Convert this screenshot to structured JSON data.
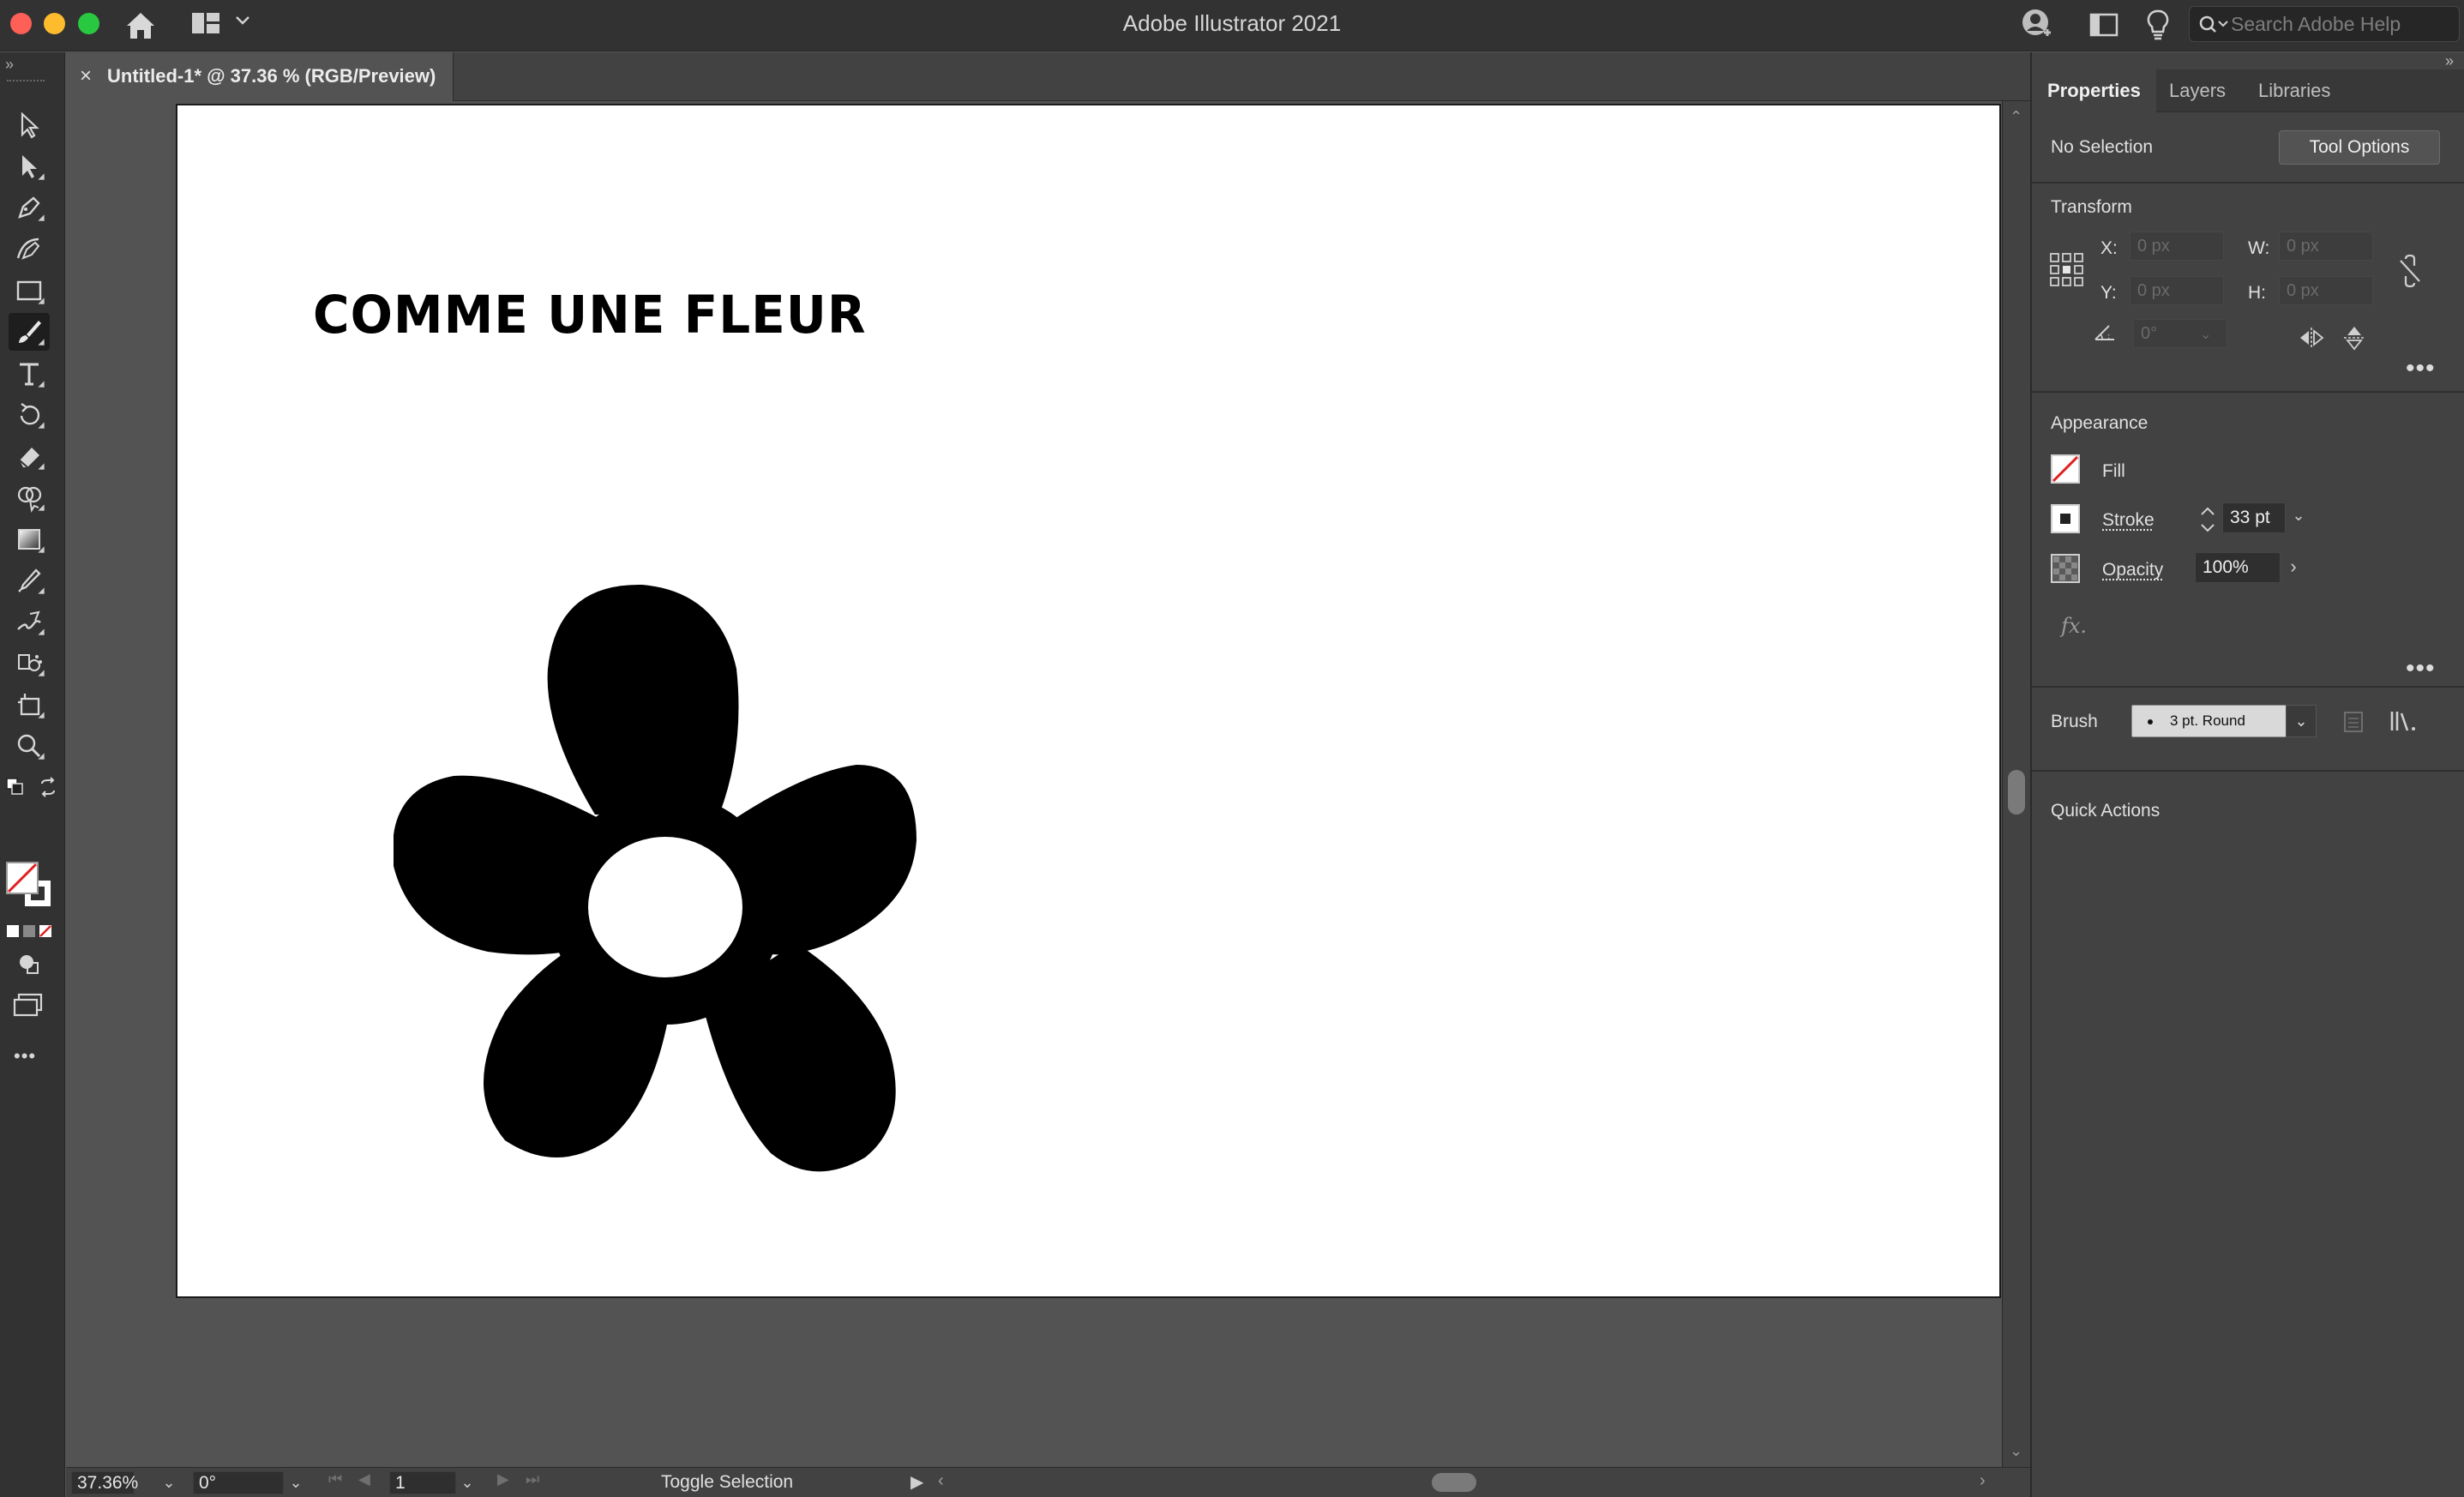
{
  "app": {
    "title": "Adobe Illustrator 2021",
    "search_placeholder": "Search Adobe Help"
  },
  "document": {
    "tab_title": "Untitled-1* @ 37.36 % (RGB/Preview)",
    "tab_close": "×",
    "artwork_heading": "COMME UNE FLEUR"
  },
  "toolbar": {
    "collapse": "»",
    "tools": [
      "selection-tool",
      "direct-selection-tool",
      "pen-tool",
      "curvature-tool",
      "rectangle-tool",
      "paintbrush-tool",
      "type-tool",
      "rotate-tool",
      "eraser-tool",
      "shape-builder-tool",
      "gradient-tool",
      "eyedropper-tool",
      "blend-tool",
      "symbol-sprayer-tool",
      "artboard-tool",
      "zoom-tool"
    ],
    "active_tool": "paintbrush-tool",
    "more": "•••"
  },
  "statusbar": {
    "zoom": "37.36%",
    "rotation": "0°",
    "artboard_number": "1",
    "toggle_label": "Toggle Selection"
  },
  "properties_panel": {
    "collapse": "»",
    "tabs": [
      "Properties",
      "Layers",
      "Libraries"
    ],
    "active_tab": "Properties",
    "selection_status": "No Selection",
    "tool_options_label": "Tool Options",
    "transform": {
      "heading": "Transform",
      "x_label": "X:",
      "y_label": "Y:",
      "w_label": "W:",
      "h_label": "H:",
      "x_value": "0 px",
      "y_value": "0 px",
      "w_value": "0 px",
      "h_value": "0 px",
      "angle_value": "0°"
    },
    "appearance": {
      "heading": "Appearance",
      "fill_label": "Fill",
      "stroke_label": "Stroke",
      "stroke_weight": "33 pt",
      "opacity_label": "Opacity",
      "opacity_value": "100%",
      "fx_label": "fx."
    },
    "brush": {
      "label": "Brush",
      "value": "3 pt. Round"
    },
    "quick_actions_heading": "Quick Actions"
  },
  "colors": {
    "chrome_dark": "#323232",
    "panel_bg": "#424242",
    "canvas_bg": "#535353",
    "artboard": "#ffffff",
    "artwork": "#000000",
    "close_red": "#fe5f57",
    "minimize_yellow": "#febb2e",
    "maximize_green": "#28c840"
  }
}
